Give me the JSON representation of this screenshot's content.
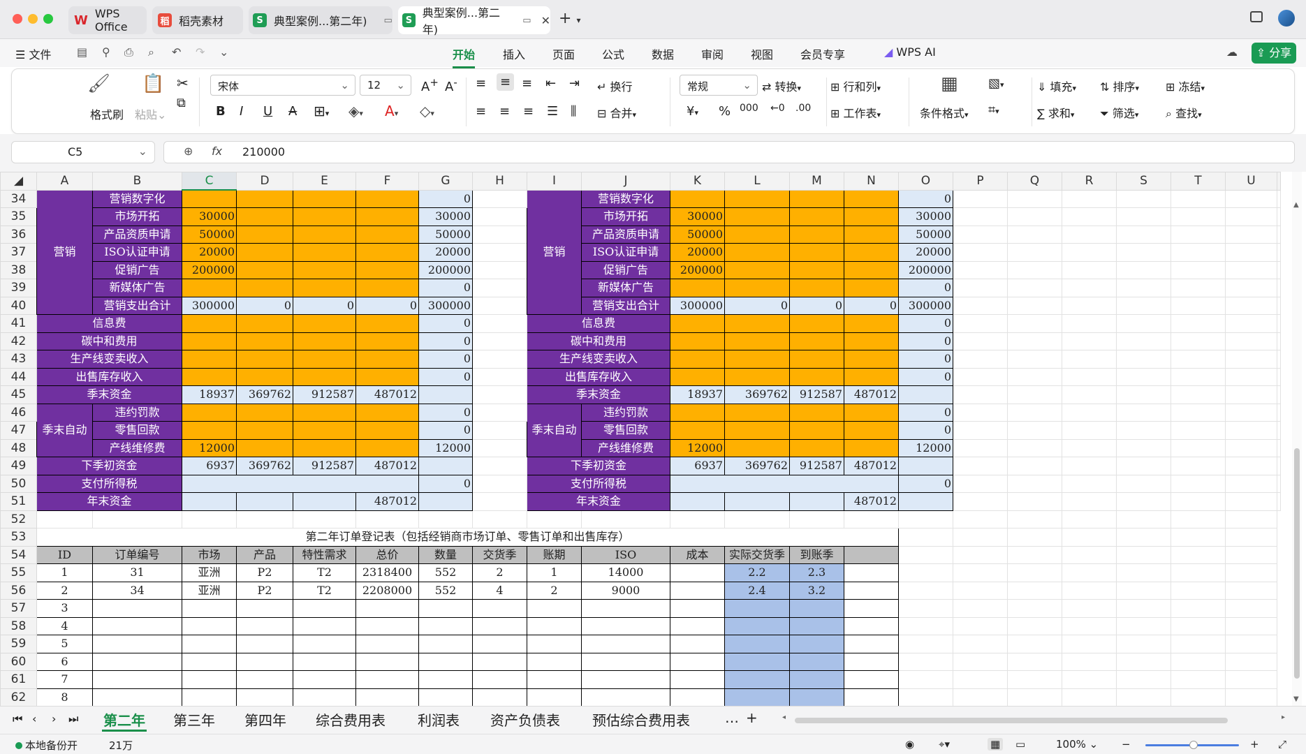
{
  "tabs": {
    "wps": "WPS Office",
    "daoke": "稻壳素材",
    "file1": "典型案例...第二年)",
    "file2": "典型案例...第二年)"
  },
  "menu": {
    "file": "文件",
    "items": [
      "开始",
      "插入",
      "页面",
      "公式",
      "数据",
      "审阅",
      "视图",
      "会员专享"
    ],
    "ai": "WPS AI",
    "share": "分享"
  },
  "ribbon": {
    "format_brush": "格式刷",
    "paste": "粘贴",
    "font": "宋体",
    "size": "12",
    "wrap": "换行",
    "merge": "合并",
    "number_format": "常规",
    "convert": "转换",
    "rows_cols": "行和列",
    "worksheet": "工作表",
    "cond_format": "条件格式",
    "fill": "填充",
    "sort": "排序",
    "freeze": "冻结",
    "sum": "求和",
    "filter": "筛选",
    "find": "查找"
  },
  "formula": {
    "cell_ref": "C5",
    "value": "210000"
  },
  "columns": [
    "A",
    "B",
    "C",
    "D",
    "E",
    "F",
    "G",
    "H",
    "I",
    "J",
    "K",
    "L",
    "M",
    "N",
    "O",
    "P",
    "Q",
    "R",
    "S",
    "T",
    "U"
  ],
  "rows": [
    "34",
    "35",
    "36",
    "37",
    "38",
    "39",
    "40",
    "41",
    "42",
    "43",
    "44",
    "45",
    "46",
    "47",
    "48",
    "49",
    "50",
    "51",
    "52",
    "53",
    "54",
    "55",
    "56",
    "57",
    "58",
    "59",
    "60",
    "61",
    "62"
  ],
  "cells": {
    "marketing": "营销",
    "season_end_auto": "季末自动",
    "digital": "营销数字化",
    "market": "市场开拓",
    "qualification": "产品资质申请",
    "iso": "ISO认证申请",
    "promo": "促销广告",
    "newmedia": "新媒体广告",
    "mkt_total": "营销支出合计",
    "info": "信息费",
    "carbon": "碳中和费用",
    "line_change": "生产线变卖收入",
    "stock_sale": "出售库存收入",
    "season_cash": "季末资金",
    "penalty": "违约罚款",
    "retail": "零售回款",
    "maint": "产线维修费",
    "next_cash": "下季初资金",
    "tax": "支付所得税",
    "year_cash": "年末资金",
    "v0": "0",
    "v30000": "30000",
    "v50000": "50000",
    "v20000": "20000",
    "v200000": "200000",
    "v300000": "300000",
    "v12000": "12000",
    "v18937": "18937",
    "v369762": "369762",
    "v912587": "912587",
    "v487012": "487012",
    "v6937": "6937",
    "order_title": "第二年订单登记表（包括经销商市场订单、零售订单和出售库存）",
    "h_id": "ID",
    "h_no": "订单编号",
    "h_market": "市场",
    "h_product": "产品",
    "h_feature": "特性需求",
    "h_total": "总价",
    "h_qty": "数量",
    "h_delivery": "交货季",
    "h_term": "账期",
    "h_iso": "ISO",
    "h_cost": "成本",
    "h_actual": "实际交货季",
    "h_arrive": "到账季",
    "r1": {
      "id": "1",
      "no": "31",
      "market": "亚洲",
      "product": "P2",
      "feature": "T2",
      "total": "2318400",
      "qty": "552",
      "delivery": "2",
      "term": "1",
      "iso": "14000",
      "actual": "2.2",
      "arrive": "2.3"
    },
    "r2": {
      "id": "2",
      "no": "34",
      "market": "亚洲",
      "product": "P2",
      "feature": "T2",
      "total": "2208000",
      "qty": "552",
      "delivery": "4",
      "term": "2",
      "iso": "9000",
      "actual": "2.4",
      "arrive": "3.2"
    },
    "ids": [
      "3",
      "4",
      "5",
      "6",
      "7",
      "8"
    ]
  },
  "sheet_tabs": [
    "第二年",
    "第三年",
    "第四年",
    "综合费用表",
    "利润表",
    "资产负债表",
    "预估综合费用表"
  ],
  "status": {
    "backup": "本地备份开",
    "count": "21万",
    "zoom": "100%"
  }
}
